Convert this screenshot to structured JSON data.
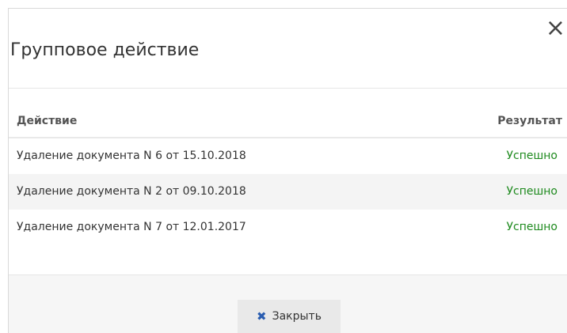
{
  "dialog": {
    "title": "Групповое действие",
    "close_icon": "×"
  },
  "table": {
    "columns": {
      "action": "Действие",
      "result": "Результат"
    },
    "rows": [
      {
        "action": "Удаление документа N 6 от 15.10.2018",
        "result": "Успешно"
      },
      {
        "action": "Удаление документа N 2 от 09.10.2018",
        "result": "Успешно"
      },
      {
        "action": "Удаление документа N 7 от 12.01.2017",
        "result": "Успешно"
      }
    ]
  },
  "footer": {
    "close_button_icon": "✖",
    "close_button_label": "Закрыть"
  },
  "colors": {
    "success": "#1e8a1e",
    "button_icon": "#2a5db0"
  }
}
